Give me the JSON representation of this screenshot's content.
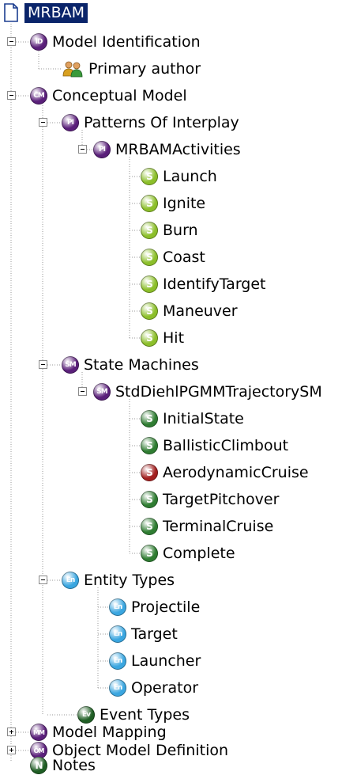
{
  "tree": {
    "root": {
      "label": "MRBAM",
      "icon": "document-icon"
    },
    "nodes": [
      {
        "label": "Model Identification",
        "icon_text": "ID",
        "icon_color": "#5a1f7a",
        "toggle": "minus"
      },
      {
        "label": "Primary author",
        "icon": "people-icon"
      },
      {
        "label": "Conceptual Model",
        "icon_text": "CM",
        "icon_color": "#5a1f7a",
        "toggle": "minus"
      },
      {
        "label": "Patterns Of Interplay",
        "icon_text": "PI",
        "icon_color": "#5a1f7a",
        "toggle": "minus"
      },
      {
        "label": "MRBAMActivities",
        "icon_text": "PI",
        "icon_color": "#5a1f7a",
        "toggle": "minus"
      },
      {
        "label": "Launch",
        "icon_text": "S",
        "icon_color": "#8cbf2a"
      },
      {
        "label": "Ignite",
        "icon_text": "S",
        "icon_color": "#8cbf2a"
      },
      {
        "label": "Burn",
        "icon_text": "S",
        "icon_color": "#8cbf2a"
      },
      {
        "label": "Coast",
        "icon_text": "S",
        "icon_color": "#8cbf2a"
      },
      {
        "label": "IdentifyTarget",
        "icon_text": "S",
        "icon_color": "#8cbf2a"
      },
      {
        "label": "Maneuver",
        "icon_text": "S",
        "icon_color": "#8cbf2a"
      },
      {
        "label": "Hit",
        "icon_text": "S",
        "icon_color": "#8cbf2a"
      },
      {
        "label": "State Machines",
        "icon_text": "SM",
        "icon_color": "#5a1f7a",
        "toggle": "minus"
      },
      {
        "label": "StdDiehlPGMMTrajectorySM",
        "icon_text": "SM",
        "icon_color": "#5a1f7a",
        "toggle": "minus"
      },
      {
        "label": "InitialState",
        "icon_text": "S",
        "icon_color": "#2f7d32"
      },
      {
        "label": "BallisticClimbout",
        "icon_text": "S",
        "icon_color": "#2f7d32"
      },
      {
        "label": "AerodynamicCruise",
        "icon_text": "S",
        "icon_color": "#a32020"
      },
      {
        "label": "TargetPitchover",
        "icon_text": "S",
        "icon_color": "#2f7d32"
      },
      {
        "label": "TerminalCruise",
        "icon_text": "S",
        "icon_color": "#2f7d32"
      },
      {
        "label": "Complete",
        "icon_text": "S",
        "icon_color": "#2f7d32"
      },
      {
        "label": "Entity Types",
        "icon_text": "En",
        "icon_color": "#3aa6e0",
        "toggle": "minus"
      },
      {
        "label": "Projectile",
        "icon_text": "En",
        "icon_color": "#3aa6e0"
      },
      {
        "label": "Target",
        "icon_text": "En",
        "icon_color": "#3aa6e0"
      },
      {
        "label": "Launcher",
        "icon_text": "En",
        "icon_color": "#3aa6e0"
      },
      {
        "label": "Operator",
        "icon_text": "En",
        "icon_color": "#3aa6e0"
      },
      {
        "label": "Event Types",
        "icon_text": "Ev",
        "icon_color": "#1f5e24"
      },
      {
        "label": "Model Mapping",
        "icon_text": "MM",
        "icon_color": "#5a1f7a",
        "toggle": "plus"
      },
      {
        "label": "Object Model Definition",
        "icon_text": "OM",
        "icon_color": "#5a1f7a",
        "toggle": "plus"
      },
      {
        "label": "Notes",
        "icon_text": "N",
        "icon_color": "#1f5e24"
      }
    ]
  }
}
